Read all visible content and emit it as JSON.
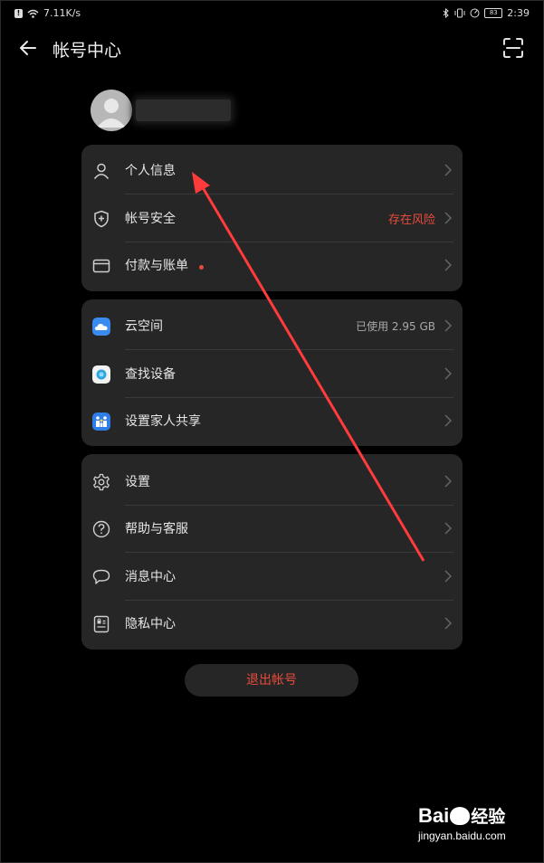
{
  "status_bar": {
    "net_speed": "7.11K/s",
    "battery": "83",
    "time": "2:39"
  },
  "header": {
    "title": "帐号中心"
  },
  "card1": {
    "personal_info": "个人信息",
    "account_security": "帐号安全",
    "account_security_status": "存在风险",
    "payment": "付款与账单"
  },
  "card2": {
    "cloud": "云空间",
    "cloud_usage": "已使用 2.95 GB",
    "find_device": "查找设备",
    "family_sharing": "设置家人共享"
  },
  "card3": {
    "settings": "设置",
    "help": "帮助与客服",
    "messages": "消息中心",
    "privacy": "隐私中心"
  },
  "logout": "退出帐号",
  "watermark": {
    "logo_left": "Bai",
    "logo_right": "经验",
    "url": "jingyan.baidu.com"
  },
  "colors": {
    "background": "#000000",
    "card": "#262626",
    "accent_red": "#e84a3d",
    "annotation_arrow": "#ff3b3b"
  },
  "icons": [
    "back-arrow-icon",
    "scan-icon",
    "person-icon",
    "shield-icon",
    "card-icon",
    "cloud-icon",
    "find-device-icon",
    "family-icon",
    "gear-icon",
    "help-icon",
    "chat-icon",
    "privacy-icon",
    "chevron-right-icon"
  ]
}
